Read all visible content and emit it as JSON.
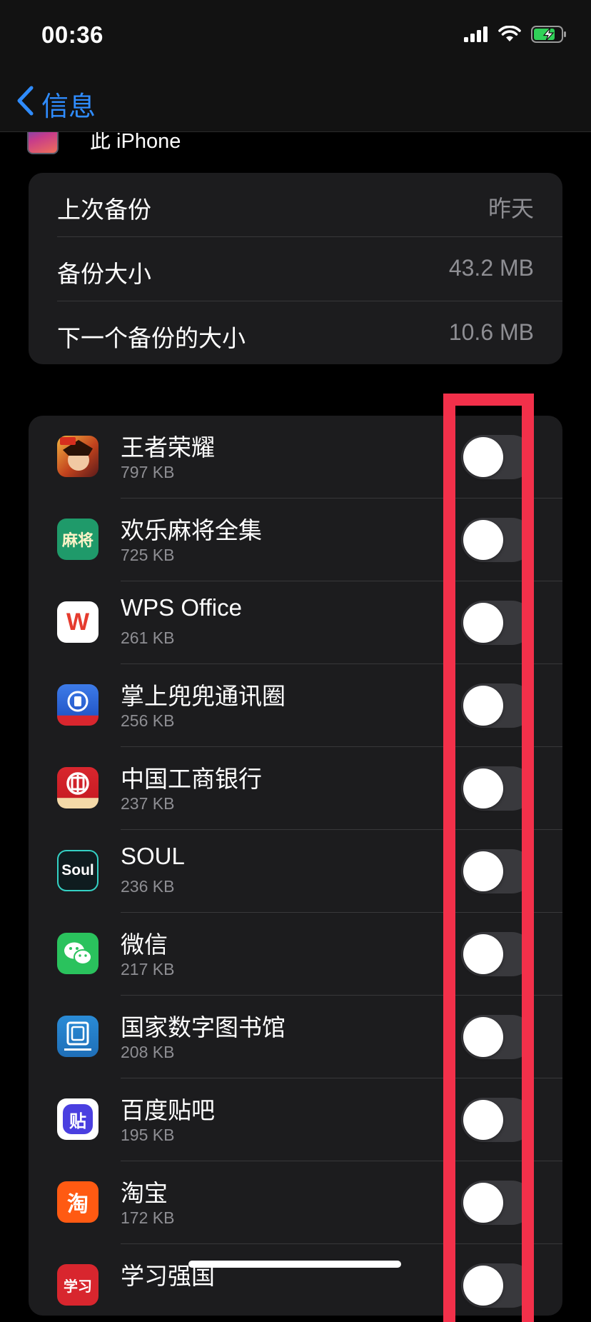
{
  "status_bar": {
    "time": "00:36",
    "signal_icon": "cellular-signal-icon",
    "wifi_icon": "wifi-icon",
    "battery_icon": "battery-charging-icon",
    "battery_color": "#30d158"
  },
  "nav": {
    "back_label": "信息",
    "accent_color": "#2f8cff"
  },
  "device": {
    "name": "此 iPhone"
  },
  "backup_info": [
    {
      "label": "上次备份",
      "value": "昨天"
    },
    {
      "label": "备份大小",
      "value": "43.2 MB"
    },
    {
      "label": "下一个备份的大小",
      "value": "10.6 MB"
    }
  ],
  "apps": [
    {
      "name": "王者荣耀",
      "size": "797 KB",
      "icon": "honor-of-kings-icon",
      "enabled": false
    },
    {
      "name": "欢乐麻将全集",
      "size": "725 KB",
      "icon": "mahjong-icon",
      "enabled": false
    },
    {
      "name": "WPS Office",
      "size": "261 KB",
      "icon": "wps-office-icon",
      "enabled": false
    },
    {
      "name": "掌上兜兜通讯圈",
      "size": "256 KB",
      "icon": "doudou-icon",
      "enabled": false
    },
    {
      "name": "中国工商银行",
      "size": "237 KB",
      "icon": "icbc-icon",
      "enabled": false
    },
    {
      "name": "SOUL",
      "size": "236 KB",
      "icon": "soul-icon",
      "enabled": false
    },
    {
      "name": "微信",
      "size": "217 KB",
      "icon": "wechat-icon",
      "enabled": false
    },
    {
      "name": "国家数字图书馆",
      "size": "208 KB",
      "icon": "national-library-icon",
      "enabled": false
    },
    {
      "name": "百度贴吧",
      "size": "195 KB",
      "icon": "baidu-tieba-icon",
      "enabled": false
    },
    {
      "name": "淘宝",
      "size": "172 KB",
      "icon": "taobao-icon",
      "enabled": false
    },
    {
      "name": "学习强国",
      "size": "",
      "icon": "xuexi-qiangguo-icon",
      "enabled": false
    }
  ],
  "icon_glyphs": {
    "wps": "W",
    "soul": "Soul",
    "tieba": "贴",
    "taobao": "淘",
    "mahjong": "麻将",
    "xuexi": "学习"
  },
  "highlight_color": "#f2304a"
}
